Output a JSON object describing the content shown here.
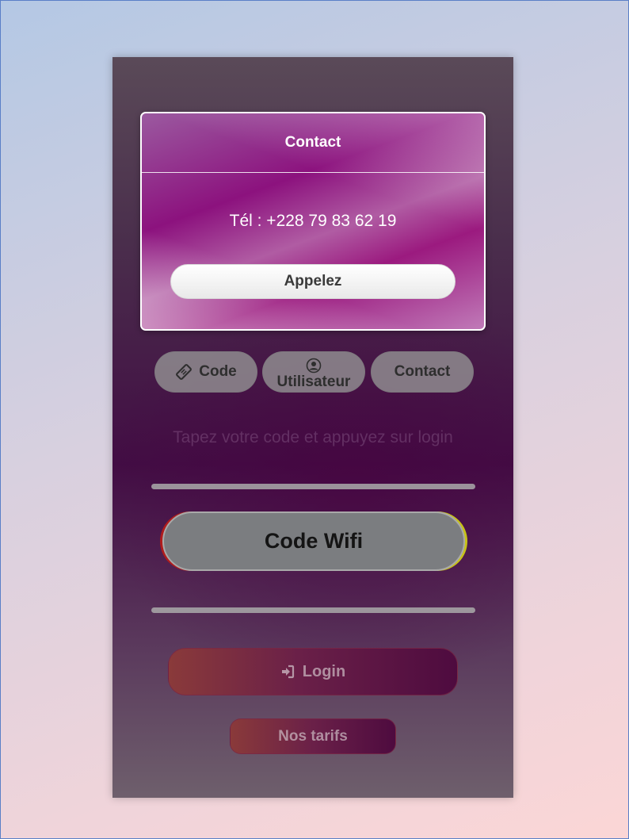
{
  "modal": {
    "title": "Contact",
    "phone_text": "Tél : +228 79 83 62 19",
    "call_button_label": "Appelez"
  },
  "tabs": [
    {
      "label": "Code",
      "icon": "ticket-icon"
    },
    {
      "label": "Utilisateur",
      "icon": "user-circle-icon"
    },
    {
      "label": "Contact",
      "icon": ""
    }
  ],
  "hint": "Tapez votre code et appuyez sur login",
  "code_field": {
    "placeholder": "Code Wifi"
  },
  "login_button": {
    "label": "Login",
    "icon": "sign-in-icon"
  },
  "tarifs_button": {
    "label": "Nos tarifs"
  },
  "colors": {
    "modal_accent": "#8c127e",
    "background_top": "#b4c8e4",
    "background_bottom": "#fbd6d6",
    "button_gradient_start": "#8a3a3a",
    "button_gradient_end": "#4e0b3f"
  }
}
